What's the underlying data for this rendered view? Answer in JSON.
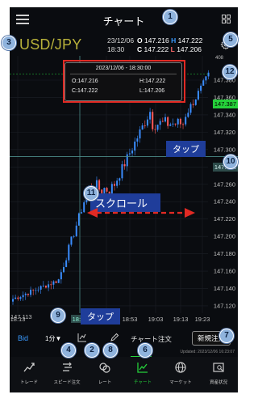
{
  "header": {
    "title": "チャート"
  },
  "info": {
    "symbol": "USD/JPY",
    "date": "23/12/06",
    "time": "18:30",
    "open_label": "O",
    "open": "147.216",
    "high_label": "H",
    "high": "147.222",
    "close_label": "C",
    "close": "147.222",
    "low_label": "L",
    "low": "147.206"
  },
  "chart": {
    "price_ticks": [
      "147.380",
      "147.360",
      "147.340",
      "147.320",
      "147.300",
      "147.280",
      "147.260",
      "147.240",
      "147.220",
      "147.200",
      "147.180",
      "147.160",
      "147.140",
      "147.120"
    ],
    "time_ticks": [
      "18:13",
      "18:43",
      "18:53",
      "19:03",
      "19:13",
      "19:23"
    ],
    "current_price": "147.387",
    "crosshair_price": "147.292",
    "crosshair_time": "18:30",
    "left_price": "147.113",
    "top_price_fragment": "408",
    "popup": {
      "datetime": "2023/12/06 - 18:30:00",
      "open": "O:147.216",
      "high": "H:147.222",
      "close": "C:147.222",
      "low": "L:147.206"
    }
  },
  "annotations": {
    "tap1": "タップ",
    "tap2": "タップ",
    "scroll": "スクロール",
    "numbers": [
      "1",
      "2",
      "3",
      "4",
      "5",
      "6",
      "7",
      "8",
      "9",
      "10",
      "11",
      "12"
    ]
  },
  "toolbar": {
    "bid": "Bid",
    "interval": "1分▼",
    "chart_order": "チャート注文",
    "new_order": "新規注文"
  },
  "status": {
    "updated": "Updated: 2023/12/06 16:23:07"
  },
  "nav": {
    "items": [
      {
        "label": "トレード"
      },
      {
        "label": "スピード注文"
      },
      {
        "label": "レート"
      },
      {
        "label": "チャート"
      },
      {
        "label": "マーケット"
      },
      {
        "label": "資産状況"
      }
    ]
  },
  "colors": {
    "up_candle": "#3a8dff",
    "down_candle": "#ff5a5a",
    "current_price": "#25d03a",
    "crosshair": "#4d8d89",
    "annotation_red": "#e22a24"
  }
}
